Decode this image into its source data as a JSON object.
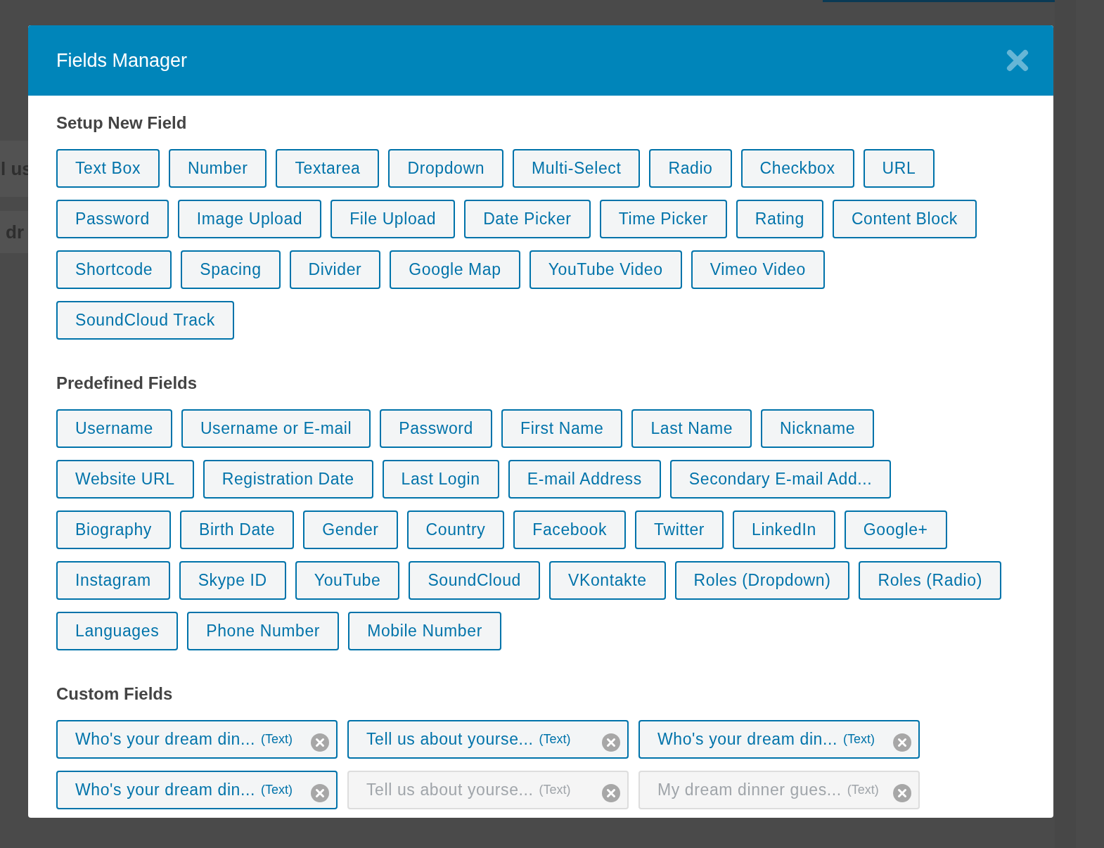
{
  "background": {
    "fragments": [
      "l us",
      "dr"
    ]
  },
  "dialog": {
    "title": "Fields Manager",
    "sections": [
      {
        "title": "Setup New Field",
        "buttons": [
          "Text Box",
          "Number",
          "Textarea",
          "Dropdown",
          "Multi-Select",
          "Radio",
          "Checkbox",
          "URL",
          "Password",
          "Image Upload",
          "File Upload",
          "Date Picker",
          "Time Picker",
          "Rating",
          "Content Block",
          "Shortcode",
          "Spacing",
          "Divider",
          "Google Map",
          "YouTube Video",
          "Vimeo Video",
          "SoundCloud Track"
        ]
      },
      {
        "title": "Predefined Fields",
        "buttons": [
          "Username",
          "Username or E-mail",
          "Password",
          "First Name",
          "Last Name",
          "Nickname",
          "Website URL",
          "Registration Date",
          "Last Login",
          "E-mail Address",
          "Secondary E-mail Add...",
          "Biography",
          "Birth Date",
          "Gender",
          "Country",
          "Facebook",
          "Twitter",
          "LinkedIn",
          "Google+",
          "Instagram",
          "Skype ID",
          "YouTube",
          "SoundCloud",
          "VKontakte",
          "Roles (Dropdown)",
          "Roles (Radio)",
          "Languages",
          "Phone Number",
          "Mobile Number"
        ]
      },
      {
        "title": "Custom Fields",
        "custom_fields": [
          {
            "label": "Who's your dream din...",
            "type": "(Text)",
            "disabled": false
          },
          {
            "label": "Tell us about yourse...",
            "type": "(Text)",
            "disabled": false
          },
          {
            "label": "Who's your dream din...",
            "type": "(Text)",
            "disabled": false
          },
          {
            "label": "Who's your dream din...",
            "type": "(Text)",
            "disabled": false
          },
          {
            "label": "Tell us about yourse...",
            "type": "(Text)",
            "disabled": true
          },
          {
            "label": "My dream dinner gues...",
            "type": "(Text)",
            "disabled": true
          }
        ]
      }
    ]
  }
}
